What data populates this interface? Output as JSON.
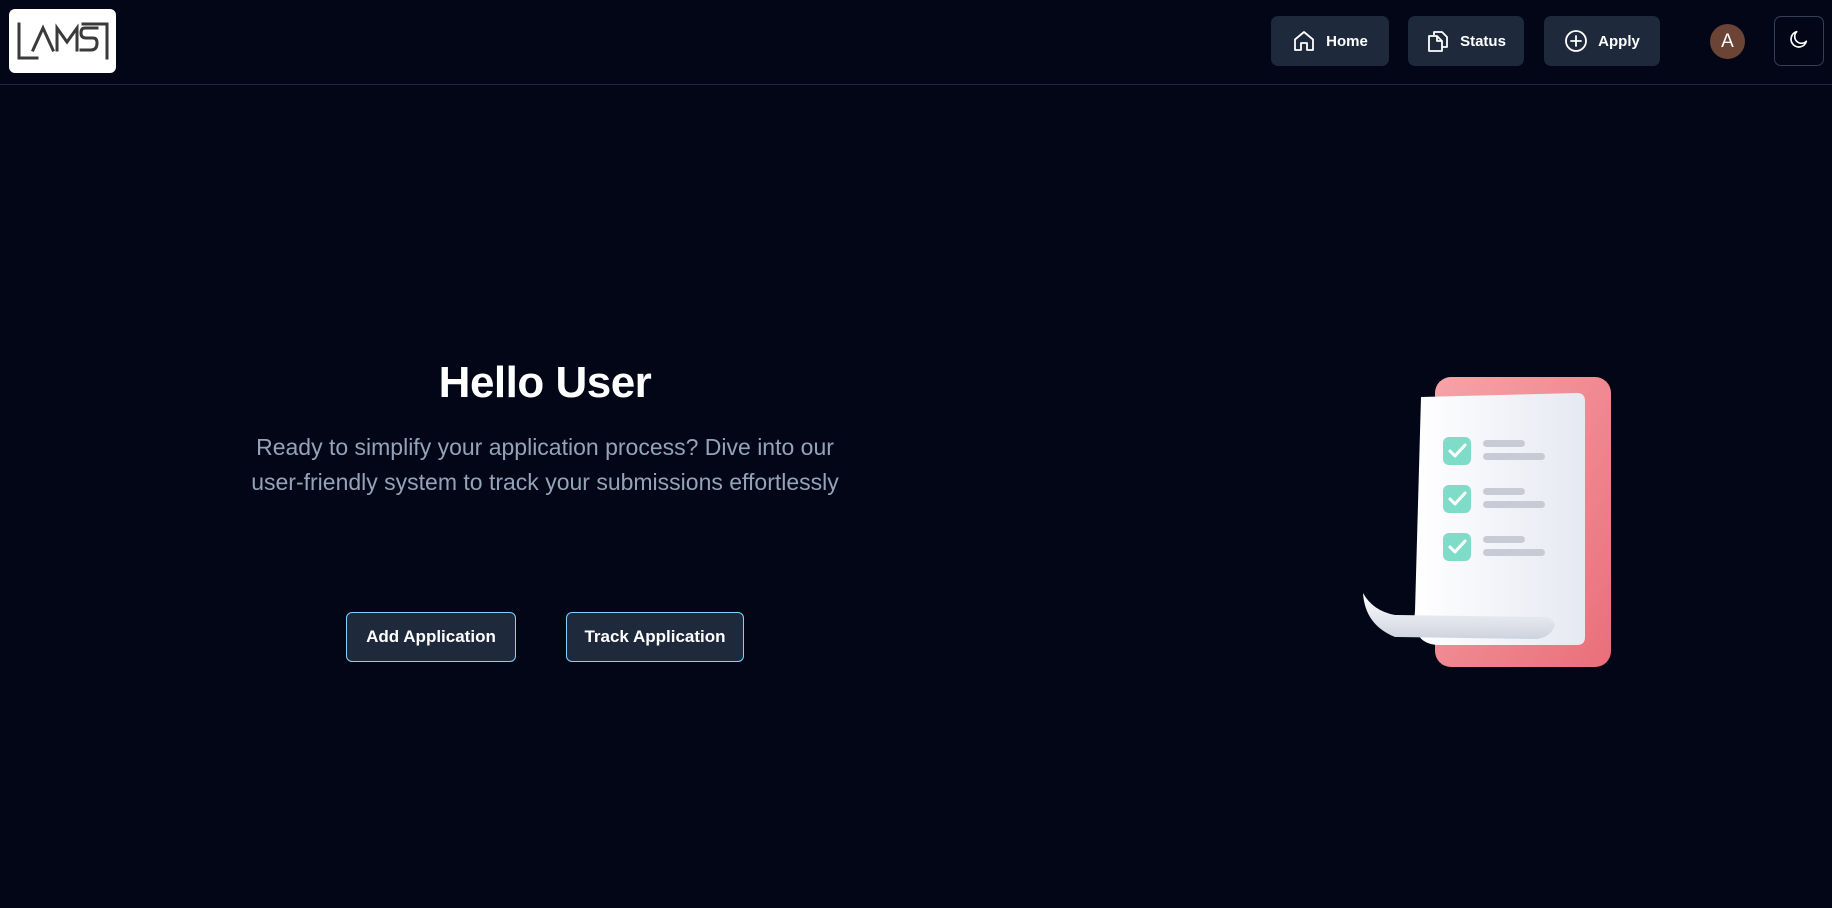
{
  "app": {
    "logo_text": "LAMS"
  },
  "nav": {
    "home_label": "Home",
    "status_label": "Status",
    "apply_label": "Apply"
  },
  "user": {
    "avatar_initial": "A"
  },
  "hero": {
    "title": "Hello User",
    "text": "Ready to simplify your application process? Dive into our user-friendly system to track your submissions effortlessly",
    "add_label": "Add Application",
    "track_label": "Track Application"
  },
  "colors": {
    "background": "#020617",
    "button_bg": "#1e293b",
    "button_border": "#7dd3fc",
    "muted_text": "#94a3b8",
    "avatar_bg": "#6b4436",
    "illustration_pink": "#f0868e",
    "illustration_check": "#7fdcc8"
  },
  "icons": {
    "home": "home-icon",
    "status": "documents-icon",
    "apply": "plus-circle-icon",
    "theme": "moon-icon"
  }
}
